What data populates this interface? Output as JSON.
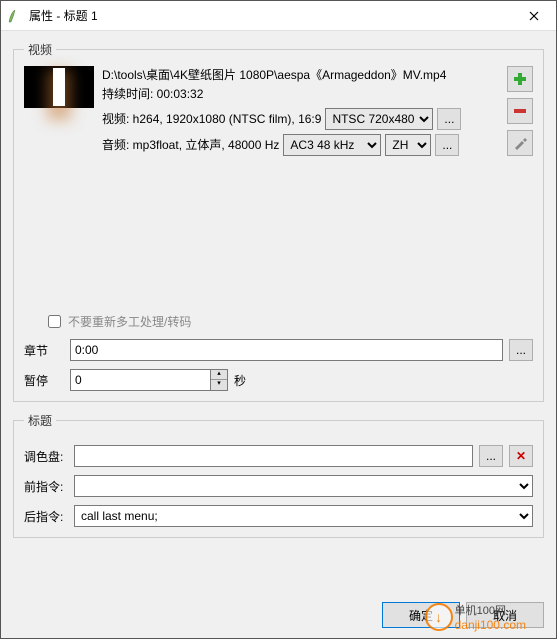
{
  "window": {
    "title": "属性 - 标题 1"
  },
  "video": {
    "legend": "视频",
    "filepath": "D:\\tools\\桌面\\4K壁纸图片 1080P\\aespa《Armageddon》MV.mp4",
    "duration_label": "持续时间: 00:03:32",
    "video_info_prefix": "视频: h264, 1920x1080 (NTSC film), 16:9",
    "video_format_selected": "NTSC 720x480",
    "audio_info_prefix": "音频: mp3float, 立体声, 48000 Hz",
    "audio_format_selected": "AC3 48 kHz",
    "audio_lang_selected": "ZH",
    "more": "...",
    "checkbox_label": "不要重新多工处理/转码",
    "chapter_label": "章节",
    "chapter_value": "0:00",
    "pause_label": "暂停",
    "pause_value": "0",
    "pause_unit": "秒"
  },
  "titling": {
    "legend": "标题",
    "palette_label": "调色盘:",
    "palette_value": "",
    "precmd_label": "前指令:",
    "precmd_value": "",
    "postcmd_label": "后指令:",
    "postcmd_value": "call last menu;"
  },
  "buttons": {
    "ok": "确定",
    "cancel": "取消"
  },
  "watermark": {
    "cn": "单机100网",
    "url": "danji100.com"
  }
}
